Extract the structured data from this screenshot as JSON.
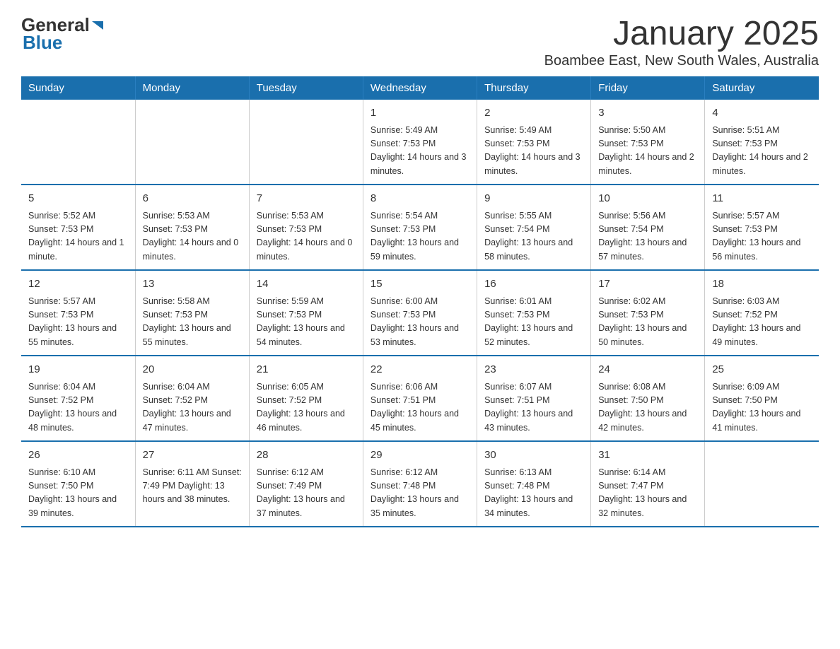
{
  "logo": {
    "text_general": "General",
    "text_blue": "Blue"
  },
  "title": "January 2025",
  "subtitle": "Boambee East, New South Wales, Australia",
  "calendar": {
    "headers": [
      "Sunday",
      "Monday",
      "Tuesday",
      "Wednesday",
      "Thursday",
      "Friday",
      "Saturday"
    ],
    "weeks": [
      [
        {
          "day": "",
          "info": ""
        },
        {
          "day": "",
          "info": ""
        },
        {
          "day": "",
          "info": ""
        },
        {
          "day": "1",
          "info": "Sunrise: 5:49 AM\nSunset: 7:53 PM\nDaylight: 14 hours\nand 3 minutes."
        },
        {
          "day": "2",
          "info": "Sunrise: 5:49 AM\nSunset: 7:53 PM\nDaylight: 14 hours\nand 3 minutes."
        },
        {
          "day": "3",
          "info": "Sunrise: 5:50 AM\nSunset: 7:53 PM\nDaylight: 14 hours\nand 2 minutes."
        },
        {
          "day": "4",
          "info": "Sunrise: 5:51 AM\nSunset: 7:53 PM\nDaylight: 14 hours\nand 2 minutes."
        }
      ],
      [
        {
          "day": "5",
          "info": "Sunrise: 5:52 AM\nSunset: 7:53 PM\nDaylight: 14 hours\nand 1 minute."
        },
        {
          "day": "6",
          "info": "Sunrise: 5:53 AM\nSunset: 7:53 PM\nDaylight: 14 hours\nand 0 minutes."
        },
        {
          "day": "7",
          "info": "Sunrise: 5:53 AM\nSunset: 7:53 PM\nDaylight: 14 hours\nand 0 minutes."
        },
        {
          "day": "8",
          "info": "Sunrise: 5:54 AM\nSunset: 7:53 PM\nDaylight: 13 hours\nand 59 minutes."
        },
        {
          "day": "9",
          "info": "Sunrise: 5:55 AM\nSunset: 7:54 PM\nDaylight: 13 hours\nand 58 minutes."
        },
        {
          "day": "10",
          "info": "Sunrise: 5:56 AM\nSunset: 7:54 PM\nDaylight: 13 hours\nand 57 minutes."
        },
        {
          "day": "11",
          "info": "Sunrise: 5:57 AM\nSunset: 7:53 PM\nDaylight: 13 hours\nand 56 minutes."
        }
      ],
      [
        {
          "day": "12",
          "info": "Sunrise: 5:57 AM\nSunset: 7:53 PM\nDaylight: 13 hours\nand 55 minutes."
        },
        {
          "day": "13",
          "info": "Sunrise: 5:58 AM\nSunset: 7:53 PM\nDaylight: 13 hours\nand 55 minutes."
        },
        {
          "day": "14",
          "info": "Sunrise: 5:59 AM\nSunset: 7:53 PM\nDaylight: 13 hours\nand 54 minutes."
        },
        {
          "day": "15",
          "info": "Sunrise: 6:00 AM\nSunset: 7:53 PM\nDaylight: 13 hours\nand 53 minutes."
        },
        {
          "day": "16",
          "info": "Sunrise: 6:01 AM\nSunset: 7:53 PM\nDaylight: 13 hours\nand 52 minutes."
        },
        {
          "day": "17",
          "info": "Sunrise: 6:02 AM\nSunset: 7:53 PM\nDaylight: 13 hours\nand 50 minutes."
        },
        {
          "day": "18",
          "info": "Sunrise: 6:03 AM\nSunset: 7:52 PM\nDaylight: 13 hours\nand 49 minutes."
        }
      ],
      [
        {
          "day": "19",
          "info": "Sunrise: 6:04 AM\nSunset: 7:52 PM\nDaylight: 13 hours\nand 48 minutes."
        },
        {
          "day": "20",
          "info": "Sunrise: 6:04 AM\nSunset: 7:52 PM\nDaylight: 13 hours\nand 47 minutes."
        },
        {
          "day": "21",
          "info": "Sunrise: 6:05 AM\nSunset: 7:52 PM\nDaylight: 13 hours\nand 46 minutes."
        },
        {
          "day": "22",
          "info": "Sunrise: 6:06 AM\nSunset: 7:51 PM\nDaylight: 13 hours\nand 45 minutes."
        },
        {
          "day": "23",
          "info": "Sunrise: 6:07 AM\nSunset: 7:51 PM\nDaylight: 13 hours\nand 43 minutes."
        },
        {
          "day": "24",
          "info": "Sunrise: 6:08 AM\nSunset: 7:50 PM\nDaylight: 13 hours\nand 42 minutes."
        },
        {
          "day": "25",
          "info": "Sunrise: 6:09 AM\nSunset: 7:50 PM\nDaylight: 13 hours\nand 41 minutes."
        }
      ],
      [
        {
          "day": "26",
          "info": "Sunrise: 6:10 AM\nSunset: 7:50 PM\nDaylight: 13 hours\nand 39 minutes."
        },
        {
          "day": "27",
          "info": "Sunrise: 6:11 AM\nSunset: 7:49 PM\nDaylight: 13 hours\nand 38 minutes."
        },
        {
          "day": "28",
          "info": "Sunrise: 6:12 AM\nSunset: 7:49 PM\nDaylight: 13 hours\nand 37 minutes."
        },
        {
          "day": "29",
          "info": "Sunrise: 6:12 AM\nSunset: 7:48 PM\nDaylight: 13 hours\nand 35 minutes."
        },
        {
          "day": "30",
          "info": "Sunrise: 6:13 AM\nSunset: 7:48 PM\nDaylight: 13 hours\nand 34 minutes."
        },
        {
          "day": "31",
          "info": "Sunrise: 6:14 AM\nSunset: 7:47 PM\nDaylight: 13 hours\nand 32 minutes."
        },
        {
          "day": "",
          "info": ""
        }
      ]
    ]
  }
}
